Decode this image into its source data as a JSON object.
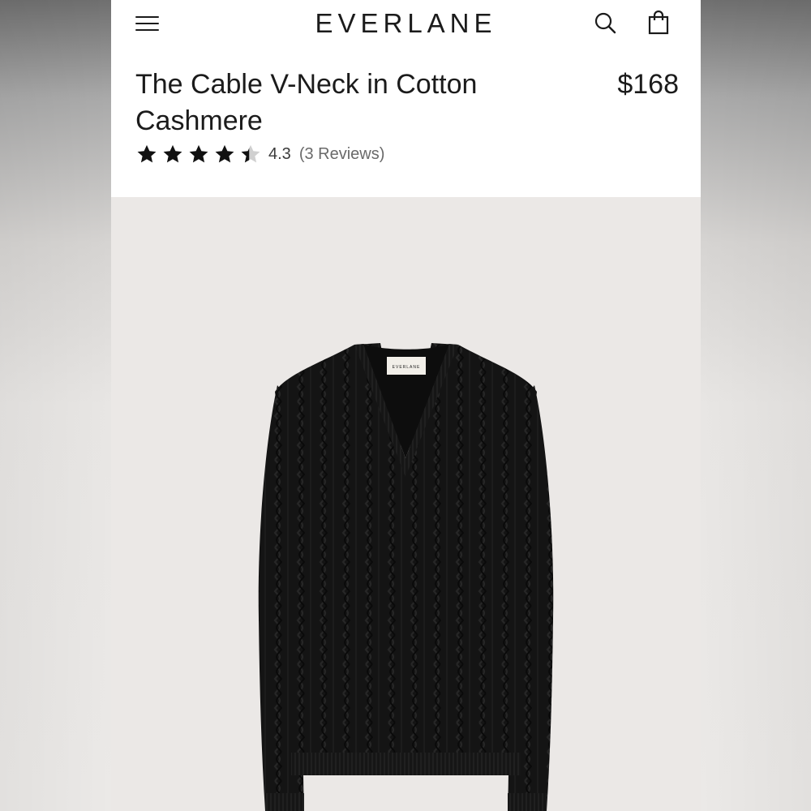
{
  "header": {
    "brand": "EVERLANE",
    "menu_icon": "hamburger-menu-icon",
    "search_icon": "search-icon",
    "bag_icon": "shopping-bag-icon"
  },
  "product": {
    "title": "The Cable V-Neck in Cotton Cashmere",
    "price": "$168",
    "rating": {
      "value": "4.3",
      "stars": 4.3,
      "max_stars": 5,
      "reviews_label": "(3 Reviews)"
    },
    "image": {
      "description_icon": "product-photo-black-cable-knit-sweater",
      "tag_text": "EVERLANE",
      "garment_color": "#131313",
      "background_color": "#ebe8e6"
    }
  },
  "colors": {
    "text": "#1b1b1b",
    "star_filled": "#111111",
    "star_empty": "#d0d0d0"
  }
}
